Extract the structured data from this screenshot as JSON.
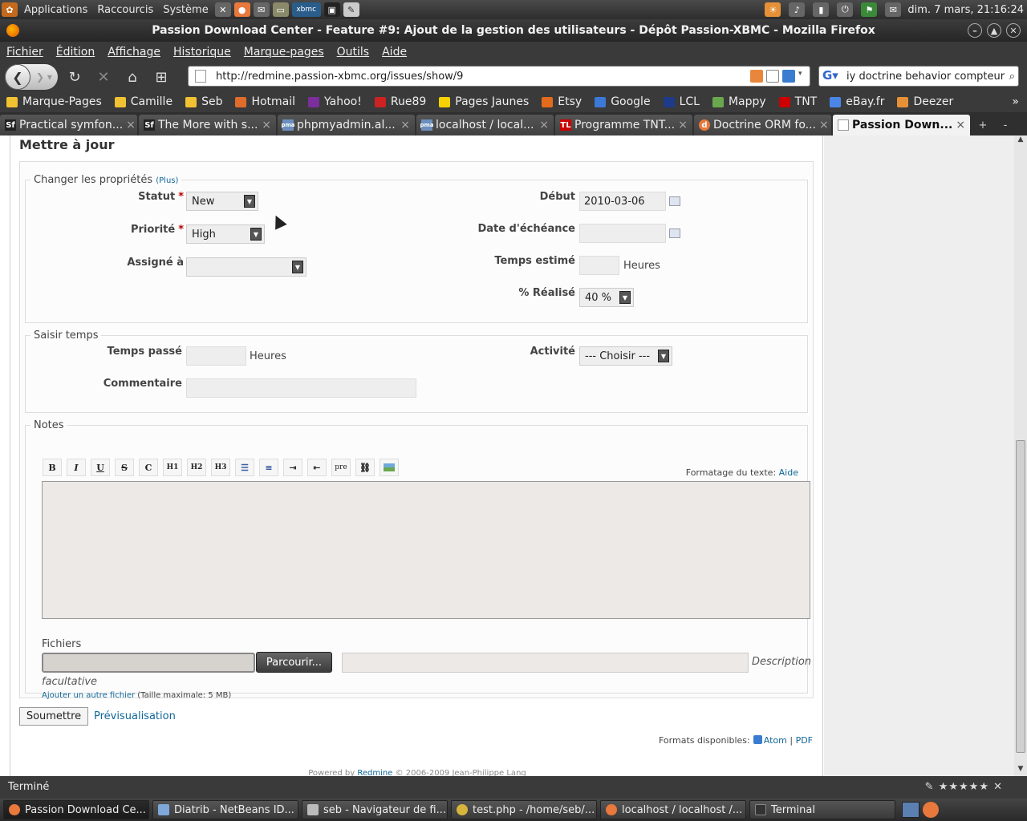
{
  "top_panel": {
    "menus": [
      "Applications",
      "Raccourcis",
      "Système"
    ],
    "clock": "dim. 7 mars, 21:16:24"
  },
  "window": {
    "title": "Passion Download Center - Feature #9: Ajout de la gestion des utilisateurs - Dépôt Passion-XBMC - Mozilla Firefox"
  },
  "menubar": [
    "Fichier",
    "Édition",
    "Affichage",
    "Historique",
    "Marque-pages",
    "Outils",
    "Aide"
  ],
  "url": "http://redmine.passion-xbmc.org/issues/show/9",
  "search_value": "iy doctrine behavior compteur",
  "bookmarks": [
    {
      "label": "Marque-Pages",
      "color": "#f1c232"
    },
    {
      "label": "Camille",
      "color": "#f1c232"
    },
    {
      "label": "Seb",
      "color": "#f1c232"
    },
    {
      "label": "Hotmail",
      "color": "#e06c2c"
    },
    {
      "label": "Yahoo!",
      "color": "#7b2e9c"
    },
    {
      "label": "Rue89",
      "color": "#cc2222"
    },
    {
      "label": "Pages Jaunes",
      "color": "#f6d200"
    },
    {
      "label": "Etsy",
      "color": "#e36b1c"
    },
    {
      "label": "Google",
      "color": "#3c78d8"
    },
    {
      "label": "LCL",
      "color": "#1d3b8a"
    },
    {
      "label": "Mappy",
      "color": "#6aa84f"
    },
    {
      "label": "TNT",
      "color": "#cc0000"
    },
    {
      "label": "eBay.fr",
      "color": "#4a86e8"
    },
    {
      "label": "Deezer",
      "color": "#e69138"
    }
  ],
  "tabs": [
    {
      "label": "Practical symfon...",
      "icon": "Sf",
      "color": "#222"
    },
    {
      "label": "The More with s...",
      "icon": "Sf",
      "color": "#222"
    },
    {
      "label": "phpmyadmin.al...",
      "icon": "pma",
      "color": "#6c8fbd"
    },
    {
      "label": "localhost / local...",
      "icon": "pma",
      "color": "#6c8fbd"
    },
    {
      "label": "Programme TNT...",
      "icon": "TL",
      "color": "#cc0000"
    },
    {
      "label": "Doctrine ORM fo...",
      "icon": "d",
      "color": "#e8783c"
    },
    {
      "label": "Passion Down...",
      "icon": "",
      "color": "#fff",
      "active": true
    }
  ],
  "page": {
    "heading": "Mettre à jour",
    "props_legend": "Changer les propriétés",
    "props_more": "(Plus)",
    "statut_label": "Statut",
    "statut_value": "New",
    "priorite_label": "Priorité",
    "priorite_value": "High",
    "assigne_label": "Assigné à",
    "assigne_value": "",
    "debut_label": "Début",
    "debut_value": "2010-03-06",
    "echeance_label": "Date d'échéance",
    "echeance_value": "",
    "temps_estime_label": "Temps estimé",
    "temps_estime_value": "",
    "heures": "Heures",
    "realise_label": "% Réalisé",
    "realise_value": "40 %",
    "saisir_legend": "Saisir temps",
    "temps_passe_label": "Temps passé",
    "temps_passe_value": "",
    "activite_label": "Activité",
    "activite_value": "--- Choisir ---",
    "commentaire_label": "Commentaire",
    "commentaire_value": "",
    "notes_legend": "Notes",
    "toolbar": [
      "B",
      "I",
      "U",
      "S",
      "C",
      "H1",
      "H2",
      "H3",
      "ul",
      "ol",
      "indent-right",
      "indent-left",
      "pre",
      "link",
      "image"
    ],
    "formatage": "Formatage du texte:",
    "formatage_aide": "Aide",
    "fichiers": "Fichiers",
    "browse": "Parcourir...",
    "description_ph_1": "Description",
    "description_ph_2": "facultative",
    "add_file": "Ajouter un autre fichier",
    "max_size": "(Taille maximale: 5 MB)",
    "submit": "Soumettre",
    "preview": "Prévisualisation",
    "formats_label": "Formats disponibles:",
    "format_atom": "Atom",
    "format_sep": "|",
    "format_pdf": "PDF",
    "footer_powered": "Powered by",
    "footer_redmine": "Redmine",
    "footer_copy": "© 2006-2009 Jean-Philippe Lang"
  },
  "status": "Terminé",
  "taskbar": [
    {
      "label": "Passion Download Ce...",
      "color": "#e8783c",
      "active": true
    },
    {
      "label": "Diatrib - NetBeans ID...",
      "color": "#7fa7d9"
    },
    {
      "label": "seb - Navigateur de fi...",
      "color": "#bbbbbb"
    },
    {
      "label": "test.php - /home/seb/...",
      "color": "#d7b53c"
    },
    {
      "label": "localhost / localhost /...",
      "color": "#e8783c"
    },
    {
      "label": "Terminal",
      "color": "#333333"
    }
  ]
}
